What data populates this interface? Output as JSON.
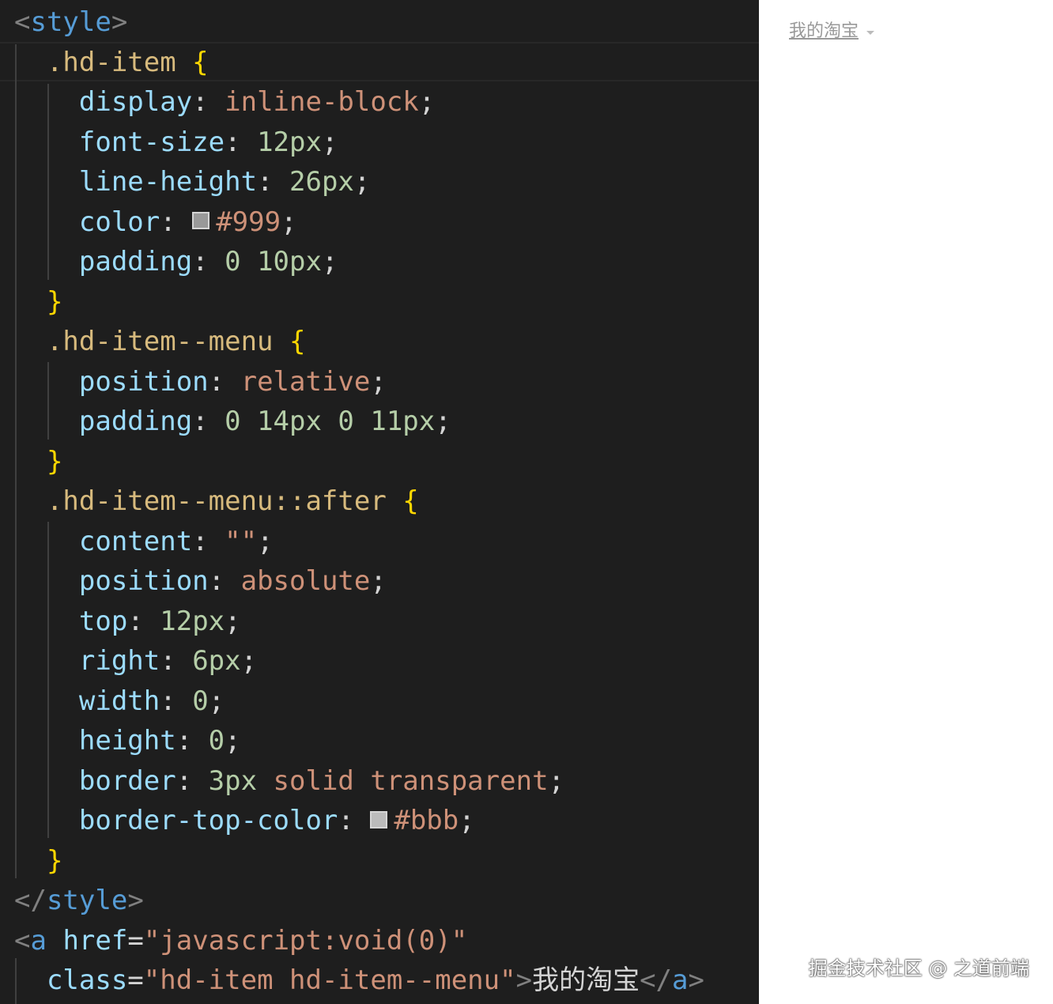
{
  "code": {
    "lines": [
      [
        {
          "t": "<",
          "c": "t-punc"
        },
        {
          "t": "style",
          "c": "t-tag"
        },
        {
          "t": ">",
          "c": "t-punc"
        }
      ],
      [
        {
          "t": "  .hd-item ",
          "c": "t-sel"
        },
        {
          "t": "{",
          "c": "t-brace"
        }
      ],
      [
        {
          "t": "    display",
          "c": "t-prop"
        },
        {
          "t": ": ",
          "c": "t-plain"
        },
        {
          "t": "inline-block",
          "c": "t-val"
        },
        {
          "t": ";",
          "c": "t-plain"
        }
      ],
      [
        {
          "t": "    font-size",
          "c": "t-prop"
        },
        {
          "t": ": ",
          "c": "t-plain"
        },
        {
          "t": "12px",
          "c": "t-num"
        },
        {
          "t": ";",
          "c": "t-plain"
        }
      ],
      [
        {
          "t": "    line-height",
          "c": "t-prop"
        },
        {
          "t": ": ",
          "c": "t-plain"
        },
        {
          "t": "26px",
          "c": "t-num"
        },
        {
          "t": ";",
          "c": "t-plain"
        }
      ],
      [
        {
          "t": "    color",
          "c": "t-prop"
        },
        {
          "t": ": ",
          "c": "t-plain"
        },
        {
          "swatch": "#999999"
        },
        {
          "t": "#999",
          "c": "t-val"
        },
        {
          "t": ";",
          "c": "t-plain"
        }
      ],
      [
        {
          "t": "    padding",
          "c": "t-prop"
        },
        {
          "t": ": ",
          "c": "t-plain"
        },
        {
          "t": "0 10px",
          "c": "t-num"
        },
        {
          "t": ";",
          "c": "t-plain"
        }
      ],
      [
        {
          "t": "  }",
          "c": "t-brace"
        }
      ],
      [
        {
          "t": "  .hd-item--menu ",
          "c": "t-sel"
        },
        {
          "t": "{",
          "c": "t-brace"
        }
      ],
      [
        {
          "t": "    position",
          "c": "t-prop"
        },
        {
          "t": ": ",
          "c": "t-plain"
        },
        {
          "t": "relative",
          "c": "t-val"
        },
        {
          "t": ";",
          "c": "t-plain"
        }
      ],
      [
        {
          "t": "    padding",
          "c": "t-prop"
        },
        {
          "t": ": ",
          "c": "t-plain"
        },
        {
          "t": "0 14px 0 11px",
          "c": "t-num"
        },
        {
          "t": ";",
          "c": "t-plain"
        }
      ],
      [
        {
          "t": "  }",
          "c": "t-brace"
        }
      ],
      [
        {
          "t": "  .hd-item--menu::after ",
          "c": "t-sel"
        },
        {
          "t": "{",
          "c": "t-brace"
        }
      ],
      [
        {
          "t": "    content",
          "c": "t-prop"
        },
        {
          "t": ": ",
          "c": "t-plain"
        },
        {
          "t": "\"\"",
          "c": "t-str"
        },
        {
          "t": ";",
          "c": "t-plain"
        }
      ],
      [
        {
          "t": "    position",
          "c": "t-prop"
        },
        {
          "t": ": ",
          "c": "t-plain"
        },
        {
          "t": "absolute",
          "c": "t-val"
        },
        {
          "t": ";",
          "c": "t-plain"
        }
      ],
      [
        {
          "t": "    top",
          "c": "t-prop"
        },
        {
          "t": ": ",
          "c": "t-plain"
        },
        {
          "t": "12px",
          "c": "t-num"
        },
        {
          "t": ";",
          "c": "t-plain"
        }
      ],
      [
        {
          "t": "    right",
          "c": "t-prop"
        },
        {
          "t": ": ",
          "c": "t-plain"
        },
        {
          "t": "6px",
          "c": "t-num"
        },
        {
          "t": ";",
          "c": "t-plain"
        }
      ],
      [
        {
          "t": "    width",
          "c": "t-prop"
        },
        {
          "t": ": ",
          "c": "t-plain"
        },
        {
          "t": "0",
          "c": "t-num"
        },
        {
          "t": ";",
          "c": "t-plain"
        }
      ],
      [
        {
          "t": "    height",
          "c": "t-prop"
        },
        {
          "t": ": ",
          "c": "t-plain"
        },
        {
          "t": "0",
          "c": "t-num"
        },
        {
          "t": ";",
          "c": "t-plain"
        }
      ],
      [
        {
          "t": "    border",
          "c": "t-prop"
        },
        {
          "t": ": ",
          "c": "t-plain"
        },
        {
          "t": "3px",
          "c": "t-num"
        },
        {
          "t": " solid transparent",
          "c": "t-val"
        },
        {
          "t": ";",
          "c": "t-plain"
        }
      ],
      [
        {
          "t": "    border-top-color",
          "c": "t-prop"
        },
        {
          "t": ": ",
          "c": "t-plain"
        },
        {
          "swatch": "#bbbbbb"
        },
        {
          "t": "#bbb",
          "c": "t-val"
        },
        {
          "t": ";",
          "c": "t-plain"
        }
      ],
      [
        {
          "t": "  }",
          "c": "t-brace"
        }
      ],
      [
        {
          "t": "</",
          "c": "t-punc"
        },
        {
          "t": "style",
          "c": "t-tag"
        },
        {
          "t": ">",
          "c": "t-punc"
        }
      ],
      [
        {
          "t": "<",
          "c": "t-punc"
        },
        {
          "t": "a",
          "c": "t-tag"
        },
        {
          "t": " href",
          "c": "t-attr"
        },
        {
          "t": "=",
          "c": "t-plain"
        },
        {
          "t": "\"javascript:void(0)\"",
          "c": "t-str"
        }
      ],
      [
        {
          "t": "  class",
          "c": "t-attr"
        },
        {
          "t": "=",
          "c": "t-plain"
        },
        {
          "t": "\"hd-item hd-item--menu\"",
          "c": "t-str"
        },
        {
          "t": ">",
          "c": "t-punc"
        },
        {
          "t": "我的淘宝",
          "c": "t-plain"
        },
        {
          "t": "</",
          "c": "t-punc"
        },
        {
          "t": "a",
          "c": "t-tag"
        },
        {
          "t": ">",
          "c": "t-punc"
        }
      ]
    ]
  },
  "preview": {
    "link_text": "我的淘宝",
    "link_color": "#999999",
    "caret_color": "#bbbbbb"
  },
  "watermark": {
    "text": "掘金技术社区 @ 之道前端"
  }
}
